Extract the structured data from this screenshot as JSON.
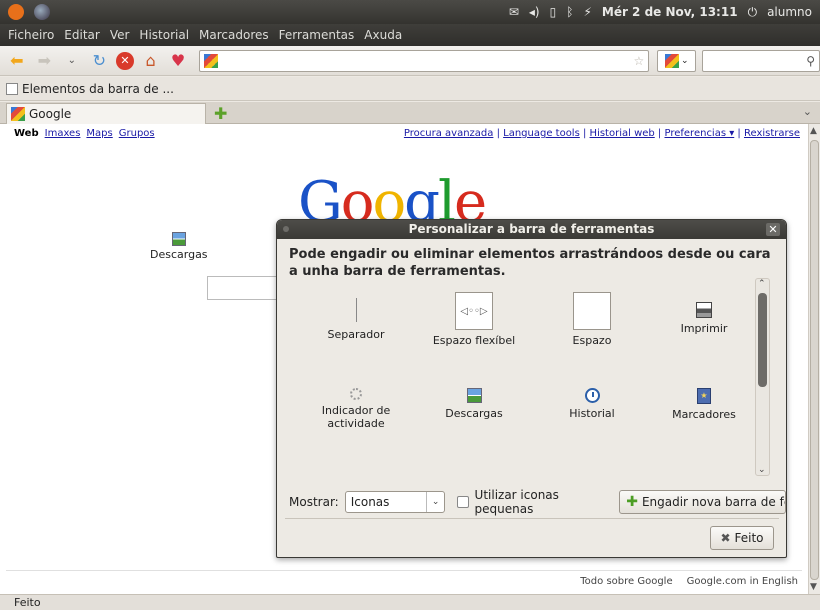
{
  "system_panel": {
    "clock": "Mér  2 de Nov, 13:11",
    "user": "alumno"
  },
  "menu": [
    "Ficheiro",
    "Editar",
    "Ver",
    "Historial",
    "Marcadores",
    "Ferramentas",
    "Axuda"
  ],
  "bookmark_item": "Elementos da barra de ...",
  "tab": {
    "label": "Google"
  },
  "google_bar": {
    "web": "Web",
    "links": [
      "Imaxes",
      "Maps",
      "Grupos"
    ],
    "user_links": [
      "Procura avanzada",
      "Language tools",
      "Historial web",
      "Preferencias ▾",
      "Rexistrarse"
    ]
  },
  "dragged_item": "Descargas",
  "footer": [
    "Todo sobre Google",
    "Google.com in English"
  ],
  "status": "Feito",
  "dialog": {
    "title": "Personalizar a barra de ferramentas",
    "instructions": "Pode engadir ou eliminar elementos arrastrándoos desde ou cara a unha barra de ferramentas.",
    "items": [
      "Separador",
      "Espazo flexíbel",
      "Espazo",
      "Imprimir",
      "Indicador de actividade",
      "Descargas",
      "Historial",
      "Marcadores"
    ],
    "show_label": "Mostrar:",
    "show_value": "Iconas",
    "small_icons_label": "Utilizar iconas pequenas",
    "add_toolbar_label": "Engadir nova barra de ferram",
    "done_label": "Feito"
  }
}
